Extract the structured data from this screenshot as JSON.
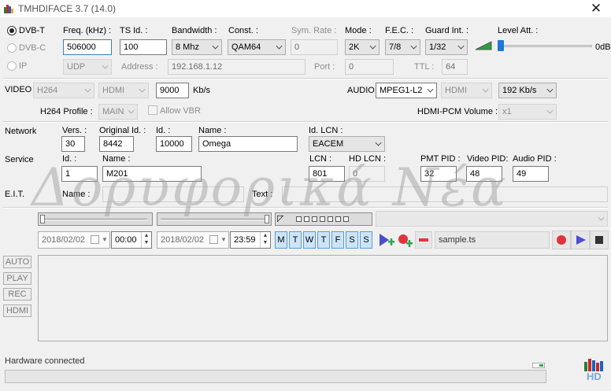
{
  "window": {
    "title": "TMHDIFACE 3.7 (14.0)"
  },
  "tuner": {
    "dvbt_label": "DVB-T",
    "dvbc_label": "DVB-C",
    "ip_label": "IP",
    "freq_label": "Freq. (kHz) :",
    "freq_value": "506000",
    "tsid_label": "TS Id. :",
    "tsid_value": "100",
    "bandwidth_label": "Bandwidth :",
    "bandwidth_value": "8 Mhz",
    "const_label": "Const. :",
    "const_value": "QAM64",
    "symrate_label": "Sym. Rate :",
    "symrate_value": "0",
    "mode_label": "Mode :",
    "mode_value": "2K",
    "fec_label": "F.E.C. :",
    "fec_value": "7/8",
    "guard_label": "Guard Int. :",
    "guard_value": "1/32",
    "level_label": "Level Att. :",
    "level_value": "0dB",
    "ip_proto_value": "UDP",
    "address_label": "Address :",
    "address_value": "192.168.1.12",
    "port_label": "Port :",
    "port_value": "0",
    "ttl_label": "TTL :",
    "ttl_value": "64"
  },
  "video": {
    "label": "VIDEO",
    "codec_value": "H264",
    "input_value": "HDMI",
    "bitrate_value": "9000",
    "bitrate_unit": "Kb/s",
    "profile_label": "H264 Profile :",
    "profile_value": "MAIN",
    "allow_vbr_label": "Allow VBR"
  },
  "audio": {
    "label": "AUDIO",
    "codec_value": "MPEG1-L2",
    "input_value": "HDMI",
    "bitrate_value": "192 Kb/s",
    "volume_label": "HDMI-PCM Volume :",
    "volume_value": "x1"
  },
  "network": {
    "label": "Network",
    "vers_label": "Vers. :",
    "vers_value": "30",
    "orig_id_label": "Original Id. :",
    "orig_id_value": "8442",
    "id_label": "Id. :",
    "id_value": "10000",
    "name_label": "Name :",
    "name_value": "Omega",
    "lcn_label": "Id. LCN :",
    "lcn_value": "EACEM"
  },
  "service": {
    "label": "Service",
    "id_label": "Id. :",
    "id_value": "1",
    "name_label": "Name :",
    "name_value": "M201",
    "lcn_label": "LCN :",
    "lcn_value": "801",
    "hdlcn_label": "HD LCN :",
    "hdlcn_value": "0",
    "pmt_label": "PMT PID :",
    "pmt_value": "32",
    "vpid_label": "Video PID:",
    "vpid_value": "48",
    "apid_label": "Audio PID :",
    "apid_value": "49"
  },
  "eit": {
    "label": "E.I.T.",
    "name_label": "Name :",
    "name_value": "",
    "text_label": "Text :",
    "text_value": ""
  },
  "schedule": {
    "start_date": "2018/02/02",
    "start_time": "00:00",
    "end_date": "2018/02/02",
    "end_time": "23:59",
    "days": [
      "M",
      "T",
      "W",
      "T",
      "F",
      "S",
      "S"
    ],
    "filename": "sample.ts"
  },
  "side_buttons": [
    "AUTO",
    "PLAY",
    "REC",
    "HDMI"
  ],
  "status": {
    "text": "Hardware connected",
    "progress": 0
  },
  "watermark": "Δορυφορικά Νέα",
  "logo_text": "HD",
  "colors": {
    "accent": "#3c7fb1",
    "record": "#e0353e",
    "play": "#4a4fd0",
    "add": "#2fa84f"
  }
}
